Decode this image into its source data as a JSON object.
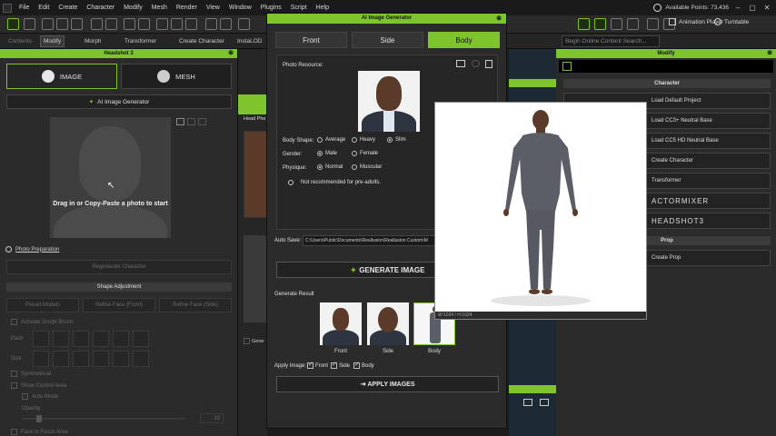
{
  "menubar": {
    "items": [
      "File",
      "Edit",
      "Create",
      "Character",
      "Modify",
      "Mesh",
      "Render",
      "View",
      "Window",
      "Plugins",
      "Script",
      "Help"
    ],
    "points_label": "Available Points: 73,436"
  },
  "toolbar2": {
    "contents": "Contents",
    "modify": "Modify",
    "morph": "Morph",
    "transformer": "Transformer",
    "create_character": "Create Character",
    "instalod": "InstaLOD",
    "animation_player": "Animation Player",
    "turntable": "Turntable",
    "search_placeholder": "Begin Online Content Search..."
  },
  "headshot": {
    "panel_title": "Headshot 3",
    "image_tab": "IMAGE",
    "mesh_tab": "MESH",
    "ai_button": "AI Image Generator",
    "drop_text": "Drag in or Copy-Paste a photo to start",
    "photo_prep": "Photo Preparation",
    "regenerate": "Regenerate Character",
    "shape_adjustment": "Shape Adjustment",
    "preset_models": "Preset Models",
    "refine_face_front": "Refine Face (Front)",
    "refine_face_side": "Refine Face (Side)",
    "activate_sculpt": "Activate Sculpt Brush",
    "pack": "Pack",
    "size": "Size",
    "symmetrical": "Symmetrical",
    "show_control_area": "Show Control Area",
    "auto_mode": "Auto Mode",
    "opacity": "Opacity",
    "face_in_focus": "Face in Focus Area",
    "opacity_value": "10"
  },
  "dialog": {
    "title": "AI Image Generator",
    "tabs": [
      "Front",
      "Side",
      "Body"
    ],
    "photo_resource": "Photo Resource:",
    "body_shape_label": "Body Shape:",
    "body_shape_options": [
      "Average",
      "Heavy",
      "Slim"
    ],
    "gender_label": "Gender:",
    "gender_options": [
      "Male",
      "Female"
    ],
    "physique_label": "Physique:",
    "physique_options": [
      "Normal",
      "Muscular"
    ],
    "warning": "Not recommended for pre-adults.",
    "autosave_label": "Auto Save:",
    "autosave_path": "C:\\Users\\Public\\Documents\\Reallusion\\Reallusion Custom\\M",
    "generate_button": "GENERATE IMAGE",
    "generate_result": "Generate Result",
    "result_labels": [
      "Front",
      "Side",
      "Body"
    ],
    "apply_image_label": "Apply Image:",
    "apply_options": [
      "Front",
      "Side",
      "Body"
    ],
    "apply_button": "APPLY IMAGES"
  },
  "middle": {
    "head_photo": "Head Pho",
    "generate": "Gene"
  },
  "preview": {
    "footer": "W:1024 / H:1024"
  },
  "modify": {
    "panel_title": "Modify",
    "character_section": "Character",
    "items": [
      "Load Default Project",
      "Load CC3+ Neutral Base",
      "Load CC5 HD Neutral Base",
      "Create Character",
      "Transformer",
      "ACTORMIXER",
      "HEADSHOT3"
    ],
    "prop_section": "Prop",
    "prop_items": [
      "Create Prop"
    ]
  },
  "colors": {
    "accent": "#7ec42c",
    "panel": "#2b2b2b",
    "background": "#1c1c1c"
  }
}
